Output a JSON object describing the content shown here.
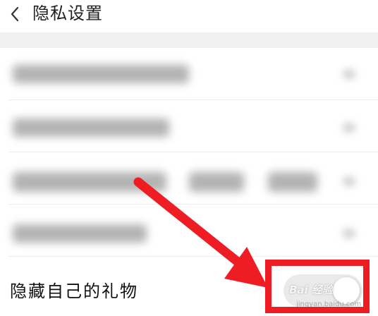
{
  "header": {
    "title": "隐私设置",
    "back_icon": "chevron-left-icon"
  },
  "settings": {
    "items": [
      {
        "label": "",
        "blurred": true
      },
      {
        "label": "",
        "blurred": true
      },
      {
        "label": "",
        "blurred": true
      },
      {
        "label": "",
        "blurred": true
      },
      {
        "label": "隐藏自己的礼物",
        "blurred": false,
        "toggle": "off"
      }
    ]
  },
  "annotation": {
    "highlight_color": "#ee1d24",
    "arrow_color": "#ee1d24"
  },
  "watermark": {
    "text": "Bai 经验",
    "subtext": "jingyan.baidu.com"
  }
}
